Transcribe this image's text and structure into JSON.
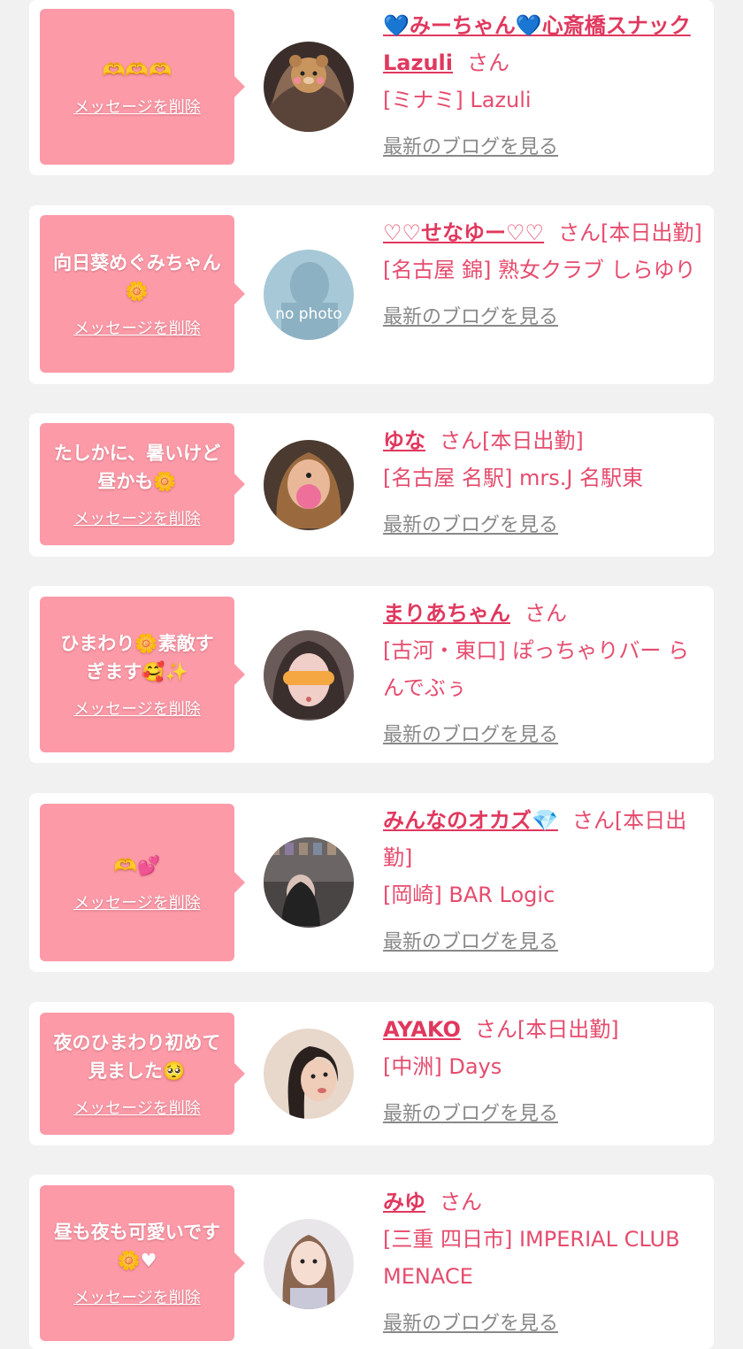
{
  "cards": [
    {
      "message": "🫶🫶🫶",
      "delete_label": "メッセージを削除",
      "name": "💙みーちゃん💙心斎橋スナックLazuli",
      "san": "さん",
      "shop": "[ミナミ] Lazuli",
      "blog_label": "最新のブログを見る"
    },
    {
      "message": "向日葵めぐみちゃん🌼",
      "delete_label": "メッセージを削除",
      "name": "♡♡せなゆー♡♡",
      "san": "さん[本日出勤]",
      "shop": "[名古屋 錦] 熟女クラブ しらゆり",
      "avatar_text": "no photo",
      "blog_label": "最新のブログを見る"
    },
    {
      "message": "たしかに、暑いけど昼かも🌼",
      "delete_label": "メッセージを削除",
      "name": "ゆな",
      "san": "さん[本日出勤]",
      "shop": "[名古屋 名駅] mrs.J 名駅東",
      "blog_label": "最新のブログを見る"
    },
    {
      "message": "ひまわり🌼素敵すぎます🥰✨",
      "delete_label": "メッセージを削除",
      "name": "まりあちゃん",
      "san": "さん",
      "shop": "[古河・東口] ぽっちゃりバー らんでぶぅ",
      "blog_label": "最新のブログを見る"
    },
    {
      "message": "🫶💕",
      "delete_label": "メッセージを削除",
      "name": "みんなのオカズ💎",
      "san": "さん[本日出勤]",
      "shop": "[岡崎] BAR Logic",
      "blog_label": "最新のブログを見る"
    },
    {
      "message": "夜のひまわり初めて見ました🥺",
      "delete_label": "メッセージを削除",
      "name": "AYAKO",
      "san": "さん[本日出勤]",
      "shop": "[中洲] Days",
      "blog_label": "最新のブログを見る"
    },
    {
      "message": "昼も夜も可愛いです🌼♥",
      "delete_label": "メッセージを削除",
      "name": "みゆ",
      "san": "さん",
      "shop": "[三重 四日市] IMPERIAL CLUB MENACE",
      "blog_label": "最新のブログを見る"
    }
  ],
  "colors": {
    "background": "#f1f1f1",
    "bubble": "#fc9aa8",
    "name_text": "#e0385e",
    "shop_text": "#e54c6e",
    "blog_link": "#888888"
  }
}
